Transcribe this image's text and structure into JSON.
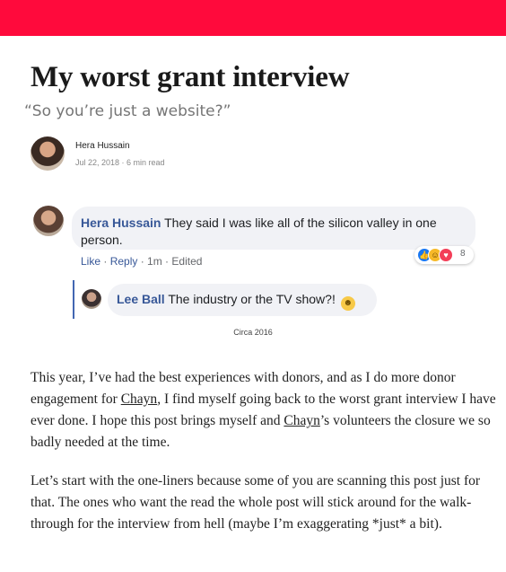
{
  "article": {
    "title": "My worst grant interview",
    "subtitle": "“So you’re just a website?”",
    "author": "Hera Hussain",
    "meta": "Jul 22, 2018 · 6 min read"
  },
  "comment": {
    "author": "Hera Hussain",
    "text": "They said I was like all of the silicon valley in one person.",
    "actions": {
      "like": "Like",
      "reply": "Reply",
      "time": "1m",
      "edited": "Edited",
      "separator": " · "
    },
    "reactions": {
      "icons": [
        "like-icon",
        "haha-icon",
        "love-icon"
      ],
      "count": "8"
    },
    "reply": {
      "author": "Lee Ball",
      "text": "The industry or the TV show?!",
      "emoji": "grinning-emoji"
    }
  },
  "caption": "Circa 2016",
  "paragraphs": {
    "p1": {
      "part1": "This year, I’ve had the best experiences with donors, and as I do more donor engagement for ",
      "link1": "Chayn",
      "part2": ", I find myself going back to the worst grant interview I have ever done. I hope this post brings myself and ",
      "link2": "Chayn",
      "part3": "’s volunteers the closure we so badly needed at the time."
    },
    "p2": "Let’s start with the one-liners because some of you are scanning this post just for that. The ones who want the read the whole post will stick around for the walk-through for the interview from hell (maybe I’m exaggerating *just* a bit)."
  },
  "colors": {
    "topbar": "#ff0a3c",
    "fb_link": "#385898"
  }
}
